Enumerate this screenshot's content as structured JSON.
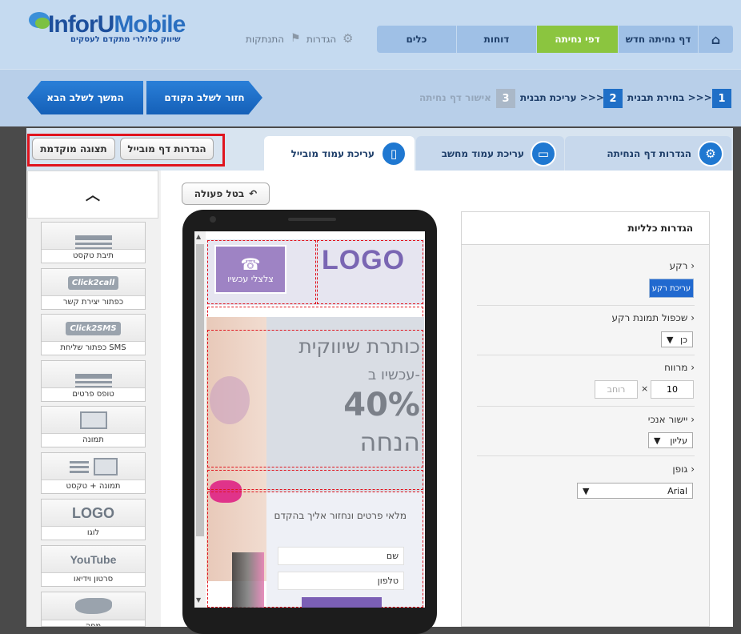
{
  "brand": {
    "name_a": "InforU",
    "name_b": "Mobile",
    "tagline": "שיווק סלולרי מתקדם לעסקים"
  },
  "header_links": {
    "settings": "הגדרות",
    "logout": "התנתקות"
  },
  "nav": [
    {
      "label": "דף נחיתה חדש"
    },
    {
      "label": "דפי נחיתה"
    },
    {
      "label": "דוחות"
    },
    {
      "label": "כלים"
    }
  ],
  "steps": {
    "s1_num": "1",
    "s1": "בחירת תבנית >>>",
    "s2_num": "2",
    "s2": "עריכת תבנית >>>",
    "s3_num": "3",
    "s3": "אישור דף נחיתה",
    "back": "חזור לשלב הקודם",
    "next": "המשך לשלב הבא"
  },
  "tabs": {
    "landing_settings": "הגדרות דף הנחיתה",
    "desktop": "עריכת עמוד מחשב",
    "mobile": "עריכת עמוד מובייל"
  },
  "toolbar": {
    "mobile_settings": "הגדרות דף מובייל",
    "preview": "תצוגה מוקדמת",
    "undo": "בטל פעולה"
  },
  "widgets": [
    {
      "label": "תיבת טקסט"
    },
    {
      "label": "כפתור יצירת קשר",
      "thumb": "Click2call"
    },
    {
      "label": "כפתור שליחת SMS",
      "thumb": "Click2SMS"
    },
    {
      "label": "טופס פרטים"
    },
    {
      "label": "תמונה"
    },
    {
      "label": "תמונה + טקסט"
    },
    {
      "label": "לוגו",
      "thumb": "LOGO"
    },
    {
      "label": "סרטון וידיאו",
      "thumb": "YouTube"
    },
    {
      "label": "מפה"
    }
  ],
  "phone": {
    "call_label": "צלצלי עכשיו",
    "logo": "LOGO",
    "hero_title": "כותרת שיווקית",
    "hero_now": "עכשיו ב-",
    "hero_pct": "40%",
    "hero_discount": "הנחה",
    "form_text": "מלאי פרטים ונחזור אליך בהקדם",
    "field_name": "שם",
    "field_phone": "טלפון"
  },
  "panel": {
    "title": "הגדרות כלליות",
    "bg_label": "רקע",
    "bg_button": "עריכת רקע",
    "dup_label": "שכפול תמונת רקע",
    "dup_value": "כן",
    "spacing_label": "מרווח",
    "spacing_value": "10",
    "width_placeholder": "רוחב",
    "times": "×",
    "valign_label": "יישור אנכי",
    "valign_value": "עליון",
    "font_label": "גופן",
    "font_value": "Arial"
  }
}
